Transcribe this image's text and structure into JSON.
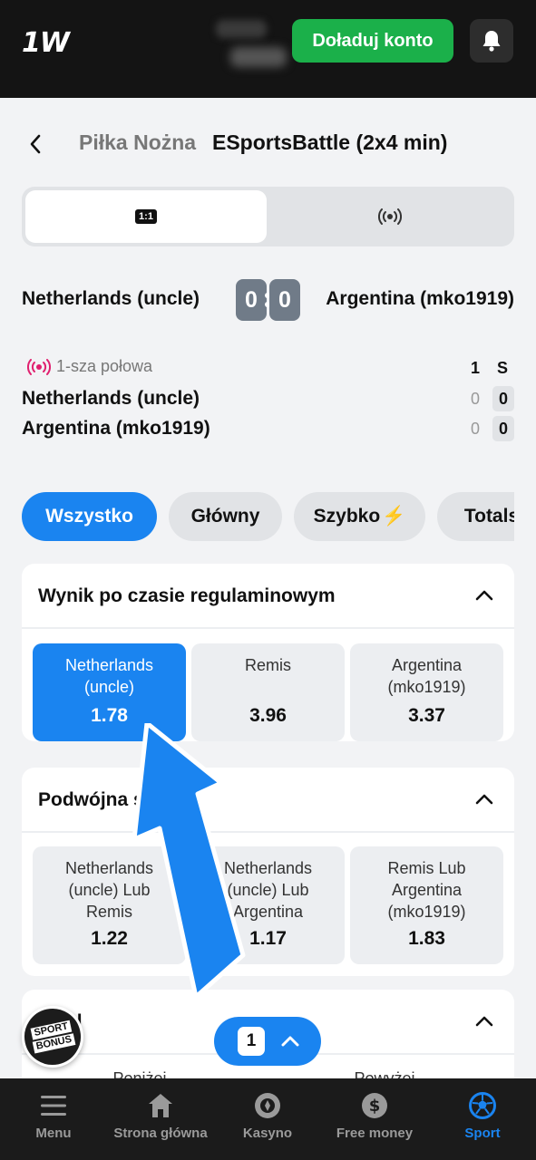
{
  "header": {
    "logo": "1W",
    "topup_label": "Doładuj konto"
  },
  "breadcrumb": {
    "sport": "Piłka Nożna",
    "title": "ESportsBattle (2x4 min)"
  },
  "match": {
    "home": "Netherlands (uncle)",
    "away": "Argentina (mko1919)",
    "home_score": "0",
    "away_score": "0"
  },
  "stats": {
    "period": "1-sza połowa",
    "col_1": "1",
    "col_s": "S",
    "rows": [
      {
        "team": "Netherlands (uncle)",
        "h1": "0",
        "total": "0"
      },
      {
        "team": "Argentina (mko1919)",
        "h1": "0",
        "total": "0"
      }
    ]
  },
  "filters": [
    "Wszystko",
    "Główny",
    "Szybko",
    "Totals"
  ],
  "markets": [
    {
      "title": "Wynik po czasie regulaminowym",
      "odds": [
        {
          "label": "Netherlands (uncle)",
          "value": "1.78"
        },
        {
          "label": "Remis",
          "value": "3.96"
        },
        {
          "label": "Argentina (mko1919)",
          "value": "3.37"
        }
      ]
    },
    {
      "title": "Podwójna szansa",
      "odds": [
        {
          "label": "Netherlands (uncle) Lub Remis",
          "value": "1.22"
        },
        {
          "label": "Netherlands (uncle) Lub Argentina",
          "value": "1.17"
        },
        {
          "label": "Remis Lub Argentina (mko1919)",
          "value": "1.83"
        }
      ]
    },
    {
      "title": "Total",
      "odds": [
        {
          "label": "Poniżej",
          "value": ""
        },
        {
          "label": "Powyżej",
          "value": ""
        }
      ]
    }
  ],
  "bonus": {
    "line1": "SPORT",
    "line2": "BONUS"
  },
  "betslip": {
    "count": "1"
  },
  "nav": [
    {
      "label": "Menu",
      "icon": "menu-icon"
    },
    {
      "label": "Strona główna",
      "icon": "home-icon"
    },
    {
      "label": "Kasyno",
      "icon": "casino-chip-icon"
    },
    {
      "label": "Free money",
      "icon": "dollar-icon"
    },
    {
      "label": "Sport",
      "icon": "soccer-ball-icon"
    }
  ],
  "colors": {
    "accent": "#1a84f0",
    "topup": "#1bb04a",
    "live": "#e0206f",
    "header_bg": "#141414"
  }
}
